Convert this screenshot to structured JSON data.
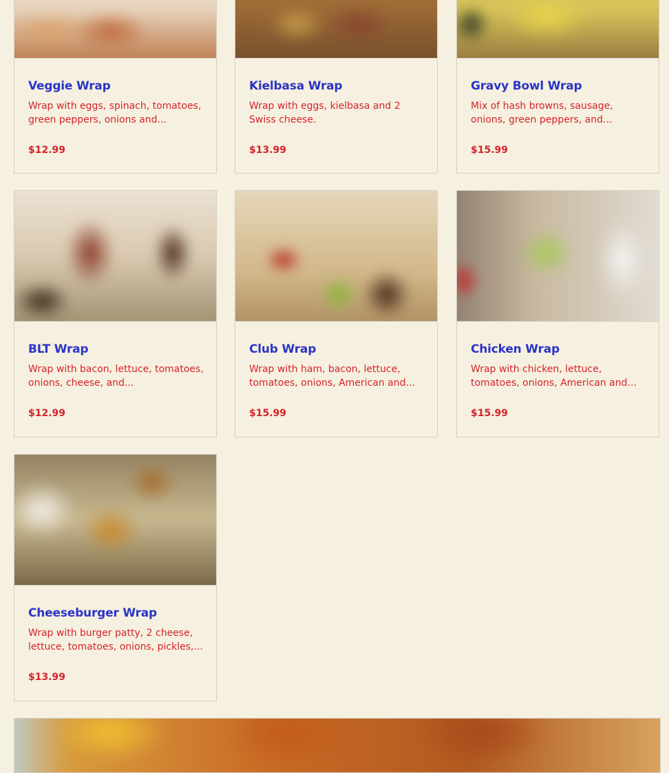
{
  "menu_items": [
    {
      "name": "Veggie Wrap",
      "description": "Wrap with eggs, spinach, tomatoes, green peppers, onions and...",
      "price": "$12.99"
    },
    {
      "name": "Kielbasa Wrap",
      "description": "Wrap with eggs, kielbasa and 2 Swiss cheese.",
      "price": "$13.99"
    },
    {
      "name": "Gravy Bowl Wrap",
      "description": "Mix of hash browns, sausage, onions, green peppers, and...",
      "price": "$15.99"
    },
    {
      "name": "BLT Wrap",
      "description": "Wrap with bacon, lettuce, tomatoes, onions, cheese, and...",
      "price": "$12.99"
    },
    {
      "name": "Club Wrap",
      "description": "Wrap with ham, bacon, lettuce, tomatoes, onions, American and...",
      "price": "$15.99"
    },
    {
      "name": "Chicken Wrap",
      "description": "Wrap with chicken, lettuce, tomatoes, onions, American and...",
      "price": "$15.99"
    },
    {
      "name": "Cheeseburger Wrap",
      "description": "Wrap with burger patty, 2 cheese, lettuce, tomatoes, onions, pickles,...",
      "price": "$13.99"
    }
  ],
  "colors": {
    "background": "#f6f0e0",
    "title": "#2b35c6",
    "accent_red": "#d3242b",
    "border": "#d4cfc3"
  }
}
